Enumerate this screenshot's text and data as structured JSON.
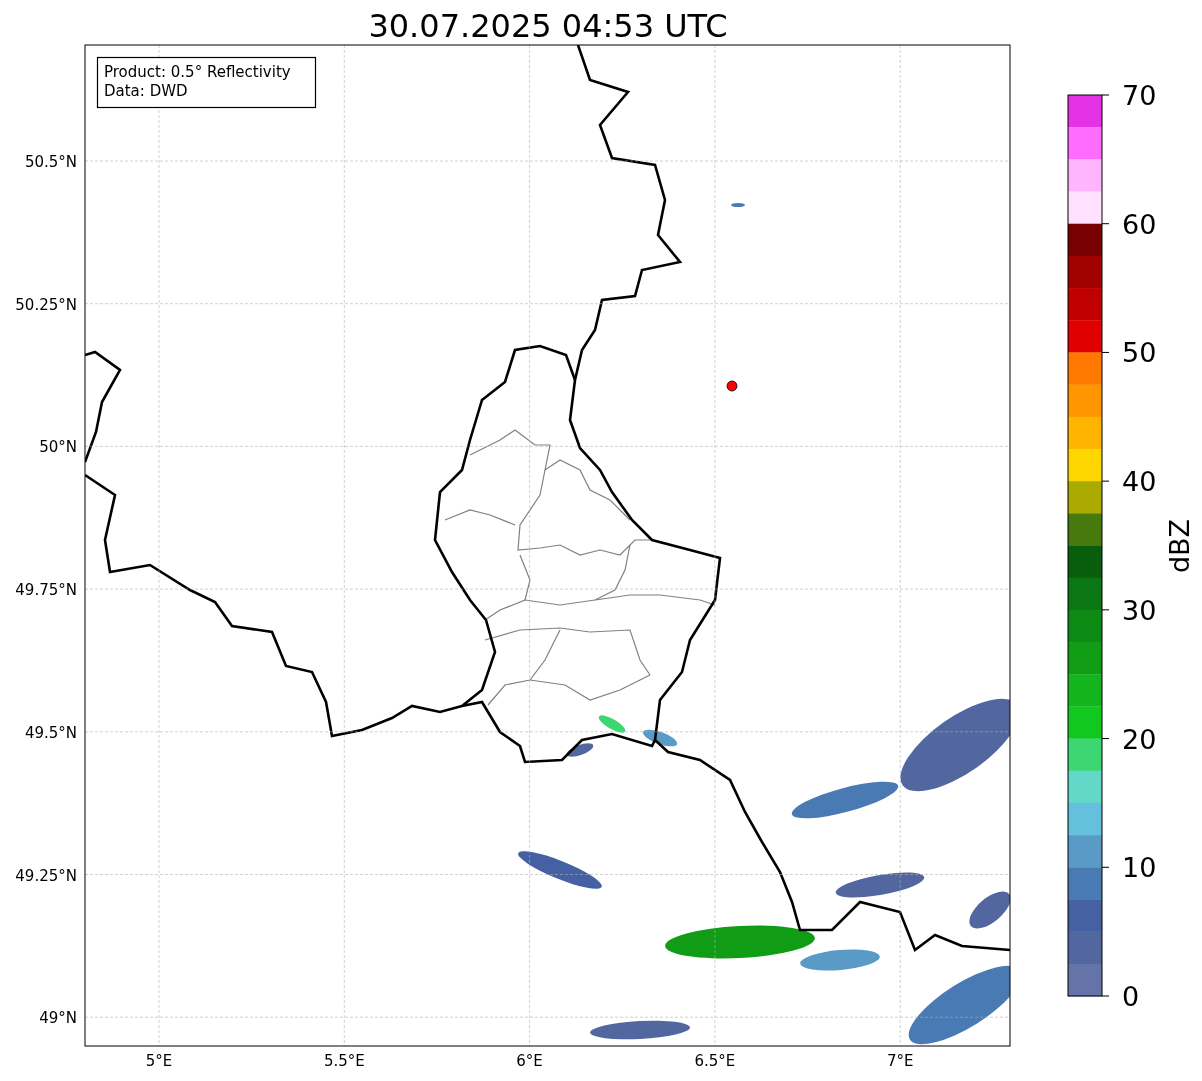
{
  "title": "30.07.2025 04:53 UTC",
  "annotation": [
    "Product: 0.5° Reflectivity",
    "Data: DWD"
  ],
  "map": {
    "lat_ticks": [
      "50.5°N",
      "50.25°N",
      "50°N",
      "49.75°N",
      "49.5°N",
      "49.25°N",
      "49°N"
    ],
    "lon_ticks": [
      "5°E",
      "5.5°E",
      "6°E",
      "6.5°E",
      "7°E"
    ]
  },
  "colorbar": {
    "label": "dBZ",
    "ticks": [
      "70",
      "60",
      "50",
      "40",
      "30",
      "20",
      "10",
      "0"
    ],
    "segments": [
      {
        "color": "#e632e6"
      },
      {
        "color": "#ff6cff"
      },
      {
        "color": "#ffb4ff"
      },
      {
        "color": "#ffe0ff"
      },
      {
        "color": "#780000"
      },
      {
        "color": "#a00000"
      },
      {
        "color": "#c00000"
      },
      {
        "color": "#e00000"
      },
      {
        "color": "#ff7800"
      },
      {
        "color": "#ff9600"
      },
      {
        "color": "#ffb400"
      },
      {
        "color": "#ffd600"
      },
      {
        "color": "#aaaa00"
      },
      {
        "color": "#467a0c"
      },
      {
        "color": "#085e0c"
      },
      {
        "color": "#0a7614"
      },
      {
        "color": "#0c8a14"
      },
      {
        "color": "#109c14"
      },
      {
        "color": "#14b41e"
      },
      {
        "color": "#10c81e"
      },
      {
        "color": "#3cd672"
      },
      {
        "color": "#64d8c8"
      },
      {
        "color": "#64c0dc"
      },
      {
        "color": "#5a9ac6"
      },
      {
        "color": "#4a7ab4"
      },
      {
        "color": "#4660a4"
      },
      {
        "color": "#5266a0"
      },
      {
        "color": "#6474a8"
      }
    ]
  }
}
